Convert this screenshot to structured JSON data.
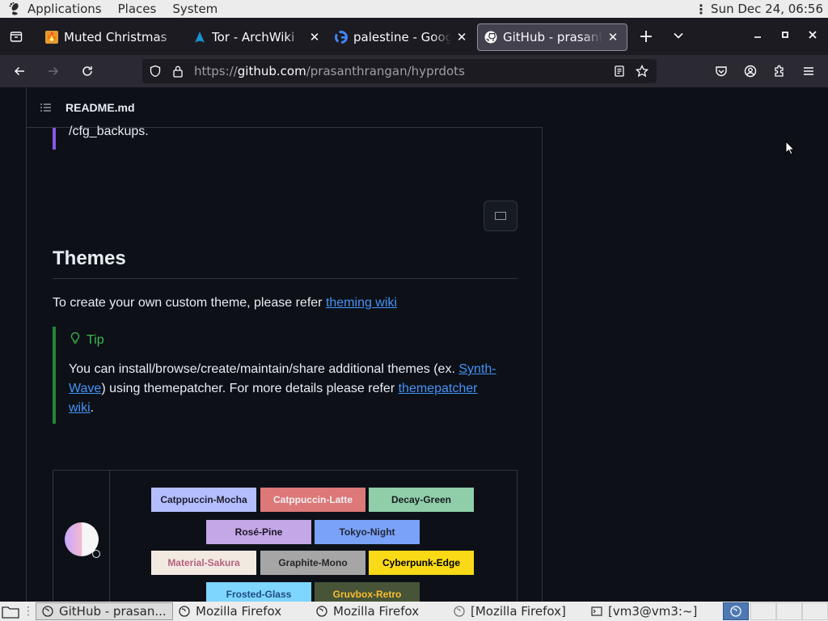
{
  "top_panel": {
    "menus": [
      "Applications",
      "Places",
      "System"
    ],
    "clock": "Sun Dec 24, 06:56"
  },
  "tabs": [
    {
      "title": "Muted Christmas",
      "favicon": "flame-icon",
      "active": false
    },
    {
      "title": "Tor - ArchWiki",
      "favicon": "arch-logo-icon",
      "active": false
    },
    {
      "title": "palestine - Google",
      "favicon": "google-icon",
      "active": false
    },
    {
      "title": "GitHub - prasanth",
      "favicon": "github-icon",
      "active": true
    }
  ],
  "urlbar": {
    "url_prefix": "https://",
    "url_domain": "github.com",
    "url_path": "/prasanthrangan/hyprdots"
  },
  "readme": {
    "filename": "README.md",
    "quote_tail": "/cfg_backups.",
    "heading": "Themes",
    "para_text": "To create your own custom theme, please refer ",
    "para_link": "theming wiki",
    "tip_title": "Tip",
    "tip_text_1": "You can install/browse/create/maintain/share additional themes (ex. ",
    "tip_link_1": "Synth-Wave",
    "tip_text_2": ") using themepatcher. For more details please refer ",
    "tip_link_2": "themepatcher wiki",
    "tip_text_3": "."
  },
  "themes": [
    {
      "name": "Catppuccin-Mocha",
      "bg": "#b4befe",
      "fg": "#1e1e2e"
    },
    {
      "name": "Catppuccin-Latte",
      "bg": "#dd7878",
      "fg": "#eff1f5"
    },
    {
      "name": "Decay-Green",
      "bg": "#90ceaa",
      "fg": "#171b20"
    },
    {
      "name": "Rosé-Pine",
      "bg": "#c4a7e7",
      "fg": "#191724"
    },
    {
      "name": "Tokyo-Night",
      "bg": "#7aa2f7",
      "fg": "#24283b"
    },
    {
      "name": "Material-Sakura",
      "bg": "#f2e9e1",
      "fg": "#b4637a"
    },
    {
      "name": "Graphite-Mono",
      "bg": "#a6a6a6",
      "fg": "#262626"
    },
    {
      "name": "Cyberpunk-Edge",
      "bg": "#fada16",
      "fg": "#000000"
    },
    {
      "name": "Frosted-Glass",
      "bg": "#7ed6ff",
      "fg": "#1e4c84"
    },
    {
      "name": "Gruvbox-Retro",
      "bg": "#475437",
      "fg": "#fabd2f"
    }
  ],
  "taskbar": {
    "items": [
      {
        "label": "GitHub - prasan...",
        "icon": "firefox-icon",
        "active": true
      },
      {
        "label": "Mozilla Firefox",
        "icon": "firefox-icon",
        "active": false
      },
      {
        "label": "Mozilla Firefox",
        "icon": "firefox-icon",
        "active": false
      },
      {
        "label": "[Mozilla Firefox]",
        "icon": "firefox-icon",
        "active": false
      },
      {
        "label": "[vm3@vm3:~]",
        "icon": "terminal-icon",
        "active": false
      }
    ]
  }
}
